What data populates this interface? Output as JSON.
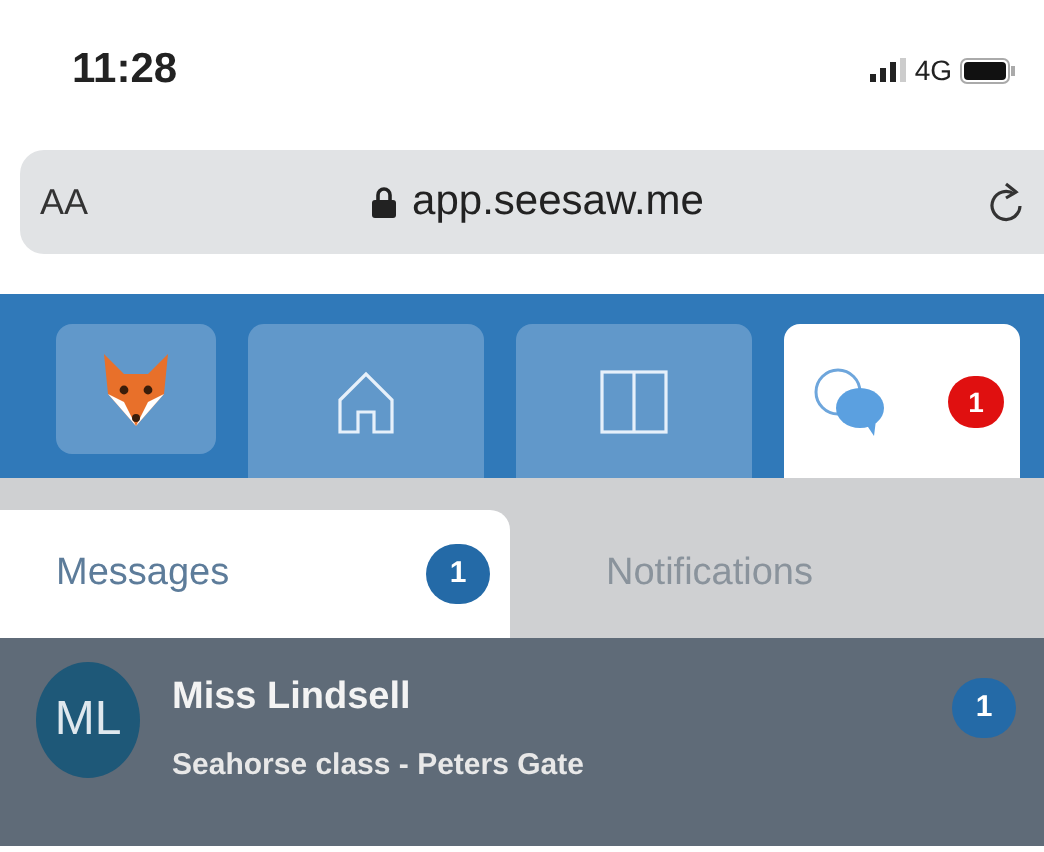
{
  "status_bar": {
    "time": "11:28",
    "network": "4G"
  },
  "address_bar": {
    "text_size": "AA",
    "url": "app.seesaw.me"
  },
  "nav_tabs": [
    {
      "kind": "avatar",
      "selected": false
    },
    {
      "kind": "home",
      "selected": false
    },
    {
      "kind": "journal",
      "selected": false
    },
    {
      "kind": "messages",
      "selected": true,
      "badge": "1"
    }
  ],
  "sub_tabs": [
    {
      "label": "Messages",
      "selected": true,
      "badge": "1"
    },
    {
      "label": "Notifications",
      "selected": false
    }
  ],
  "conversations": [
    {
      "initials": "ML",
      "name": "Miss Lindsell",
      "subtitle": "Seahorse class - Peters Gate",
      "unread": "1"
    }
  ]
}
